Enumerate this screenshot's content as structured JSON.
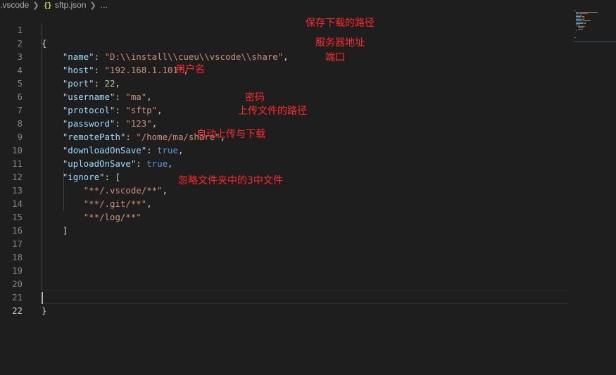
{
  "breadcrumb": {
    "folder": ".vscode",
    "json_icon_glyph": "{}",
    "file": "sftp.json",
    "more": "..."
  },
  "editor": {
    "line_numbers": [
      "1",
      "2",
      "3",
      "4",
      "5",
      "6",
      "7",
      "8",
      "9",
      "10",
      "11",
      "12",
      "13",
      "14",
      "15",
      "16",
      "17",
      "18",
      "19",
      "20",
      "21",
      "22"
    ],
    "active_line": "22",
    "lines": {
      "l1": {
        "brace": "{"
      },
      "l2": {
        "key": "\"name\"",
        "colon": ": ",
        "value": "\"D:\\\\install\\\\cueu\\\\vscode\\\\share\"",
        "comma": ","
      },
      "l3": {
        "key": "\"host\"",
        "colon": ": ",
        "value": "\"192.168.1.101\"",
        "comma": ","
      },
      "l4": {
        "key": "\"port\"",
        "colon": ": ",
        "value": "22",
        "comma": ","
      },
      "l5": {
        "key": "\"username\"",
        "colon": ": ",
        "value": "\"ma\"",
        "comma": ","
      },
      "l6": {
        "key": "\"protocol\"",
        "colon": ": ",
        "value": "\"sftp\"",
        "comma": ","
      },
      "l7": {
        "key": "\"password\"",
        "colon": ": ",
        "value": "\"123\"",
        "comma": ","
      },
      "l8": {
        "key": "\"remotePath\"",
        "colon": ": ",
        "value": "\"/home/ma/share\"",
        "comma": ","
      },
      "l9": {
        "key": "\"downloadOnSave\"",
        "colon": ": ",
        "value": "true",
        "comma": ","
      },
      "l10": {
        "key": "\"uploadOnSave\"",
        "colon": ": ",
        "value": "true",
        "comma": ","
      },
      "l11": {
        "key": "\"ignore\"",
        "colon": ": ",
        "open": "["
      },
      "l12": {
        "value": "\"**/.vscode/**\"",
        "comma": ","
      },
      "l13": {
        "value": "\"**/.git/**\"",
        "comma": ","
      },
      "l14": {
        "value": "\"**/log/**\""
      },
      "l15": {
        "close": "]"
      },
      "l21": {
        "brace": "}"
      }
    }
  },
  "annotations": {
    "save_path": "保存下载的路径",
    "server_address": "服务器地址",
    "port": "端口",
    "username": "用户名",
    "password": "密码",
    "upload_path": "上传文件的路径",
    "auto_sync": "自动上传与下载",
    "ignore_folders": "忽略文件夹中的3中文件"
  },
  "colors": {
    "background": "#1e1e1e",
    "key": "#9cdcfe",
    "string": "#ce9178",
    "number": "#b5cea8",
    "boolean": "#569cd6",
    "annotation": "#ff2a2a",
    "json_icon": "#cbcb41"
  }
}
